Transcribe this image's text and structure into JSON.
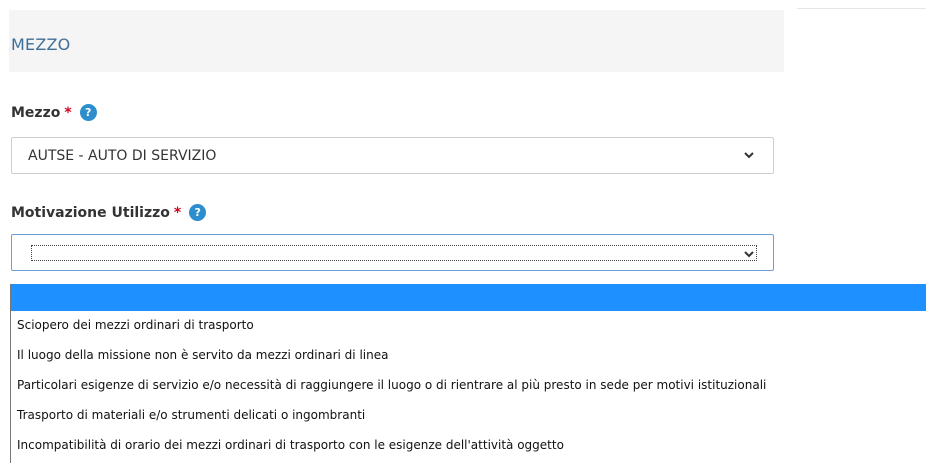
{
  "section": {
    "title": "MEZZO"
  },
  "mezzo_field": {
    "label": "Mezzo",
    "required_mark": "*",
    "help_glyph": "?",
    "selected_value": "AUTSE - AUTO DI SERVIZIO"
  },
  "motivazione_field": {
    "label": "Motivazione Utilizzo",
    "required_mark": "*",
    "help_glyph": "?",
    "selected_value": ""
  },
  "dropdown": {
    "options": [
      "",
      "Sciopero dei mezzi ordinari di trasporto",
      "Il luogo della missione non è servito da mezzi ordinari di linea",
      "Particolari esigenze di servizio e/o necessità di raggiungere il luogo o di rientrare al più presto in sede per motivi istituzionali",
      "Trasporto di materiali e/o strumenti delicati o ingombranti",
      "Incompatibilità di orario dei mezzi ordinari di trasporto con le esigenze dell'attività oggetto"
    ],
    "highlighted_index": 0
  },
  "colors": {
    "section_title": "#3e6f98",
    "required": "#d0021b",
    "help_icon": "#2d8ecd",
    "highlight": "#1e90ff"
  },
  "icons": [
    "help-icon",
    "chevron-down-icon"
  ]
}
